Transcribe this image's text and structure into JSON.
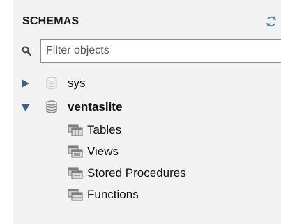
{
  "header": {
    "title": "SCHEMAS",
    "refresh_icon": "refresh-icon"
  },
  "filter": {
    "placeholder": "Filter objects",
    "value": ""
  },
  "schemas": [
    {
      "name": "sys",
      "expanded": false,
      "bold": false
    },
    {
      "name": "ventaslite",
      "expanded": true,
      "bold": true,
      "children": [
        {
          "label": "Tables",
          "icon": "tables-icon"
        },
        {
          "label": "Views",
          "icon": "views-icon"
        },
        {
          "label": "Stored Procedures",
          "icon": "stored-procedures-icon"
        },
        {
          "label": "Functions",
          "icon": "functions-icon"
        }
      ]
    }
  ]
}
